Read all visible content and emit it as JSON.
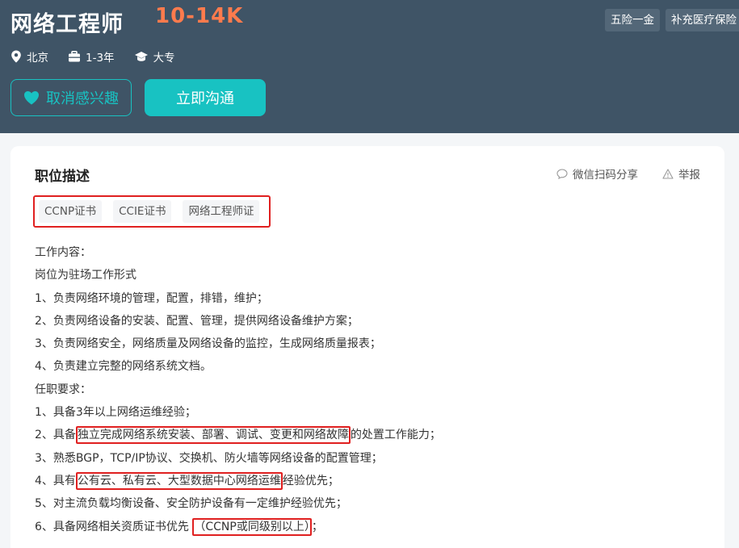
{
  "header": {
    "title": "网络工程师",
    "salary": "10-14K",
    "benefits": [
      "五险一金",
      "补充医疗保险"
    ],
    "meta": {
      "location": "北京",
      "experience": "1-3年",
      "education": "大专"
    },
    "buttons": {
      "unfavorite": "取消感兴趣",
      "chat": "立即沟通"
    },
    "colors": {
      "header_bg": "#3f5466",
      "salary": "#ff7b4d",
      "accent": "#18c2c2",
      "highlight": "#e02020"
    }
  },
  "card": {
    "section_title": "职位描述",
    "actions": {
      "share": "微信扫码分享",
      "report": "举报"
    },
    "tags": [
      "CCNP证书",
      "CCIE证书",
      "网络工程师证"
    ],
    "lines": [
      {
        "pre": "工作内容：",
        "hl": "",
        "post": ""
      },
      {
        "pre": "岗位为驻场工作形式",
        "hl": "",
        "post": ""
      },
      {
        "pre": "1、负责网络环境的管理，配置，排错，维护；",
        "hl": "",
        "post": ""
      },
      {
        "pre": "2、负责网络设备的安装、配置、管理，提供网络设备维护方案；",
        "hl": "",
        "post": ""
      },
      {
        "pre": "3、负责网络安全，网络质量及网络设备的监控，生成网络质量报表；",
        "hl": "",
        "post": ""
      },
      {
        "pre": "4、负责建立完整的网络系统文档。",
        "hl": "",
        "post": ""
      },
      {
        "pre": "任职要求：",
        "hl": "",
        "post": ""
      },
      {
        "pre": "1、具备3年以上网络运维经验；",
        "hl": "",
        "post": ""
      },
      {
        "pre": "2、具备",
        "hl": "独立完成网络系统安装、部署、调试、变更和网络故障",
        "post": "的处置工作能力；"
      },
      {
        "pre": "3、熟悉BGP，TCP/IP协议、交换机、防火墙等网络设备的配置管理；",
        "hl": "",
        "post": ""
      },
      {
        "pre": "4、具有",
        "hl": "公有云、私有云、大型数据中心网络运维",
        "post": "经验优先；"
      },
      {
        "pre": "5、对主流负载均衡设备、安全防护设备有一定维护经验优先；",
        "hl": "",
        "post": ""
      },
      {
        "pre": "6、具备网络相关资质证书优先 ",
        "hl": "（CCNP或同级别以上）",
        "post": "；"
      }
    ]
  },
  "icons": {
    "location": "location-pin-icon",
    "experience": "briefcase-icon",
    "education": "graduation-cap-icon",
    "favorite": "heart-icon",
    "share": "chat-bubble-icon",
    "report": "warning-icon"
  }
}
